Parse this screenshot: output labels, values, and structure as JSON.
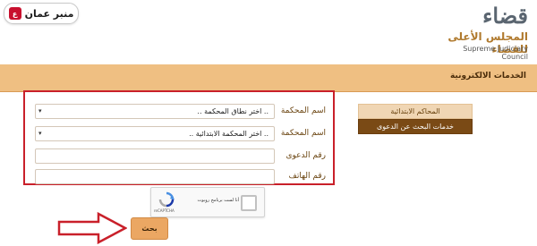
{
  "header": {
    "brand_left": "منبر عمان",
    "court_mark": "قضاء",
    "court_name_ar": "المجلس الأعلى للقضاء",
    "court_name_en": "Supreme Judiciary Council"
  },
  "banner": {
    "title": "الخدمات الالكترونية"
  },
  "menu": {
    "items": [
      {
        "label": "المحاكم الابتدائية",
        "style": "light"
      },
      {
        "label": "خدمات البحث عن الدعوى",
        "style": "dark"
      }
    ]
  },
  "form": {
    "fields": [
      {
        "label": "اسم المحكمة",
        "type": "select",
        "value": ".. اختر نطاق المحكمة .."
      },
      {
        "label": "اسم المحكمة",
        "type": "select",
        "value": ".. اختر المحكمة الابتدائية .."
      },
      {
        "label": "رقم الدعوى",
        "type": "text",
        "value": ""
      },
      {
        "label": "رقم الهاتف",
        "type": "text",
        "value": ""
      }
    ]
  },
  "captcha": {
    "label": "أنا لست برنامج روبوت",
    "brand": "reCAPTCHA"
  },
  "search_button": {
    "label": "بحث"
  },
  "colors": {
    "banner": "#efbf82",
    "highlight_border": "#c9202a",
    "menu_dark": "#7a4a15",
    "menu_light": "#f0d6b4",
    "button": "#eba763",
    "arrow": "#c9202a"
  }
}
